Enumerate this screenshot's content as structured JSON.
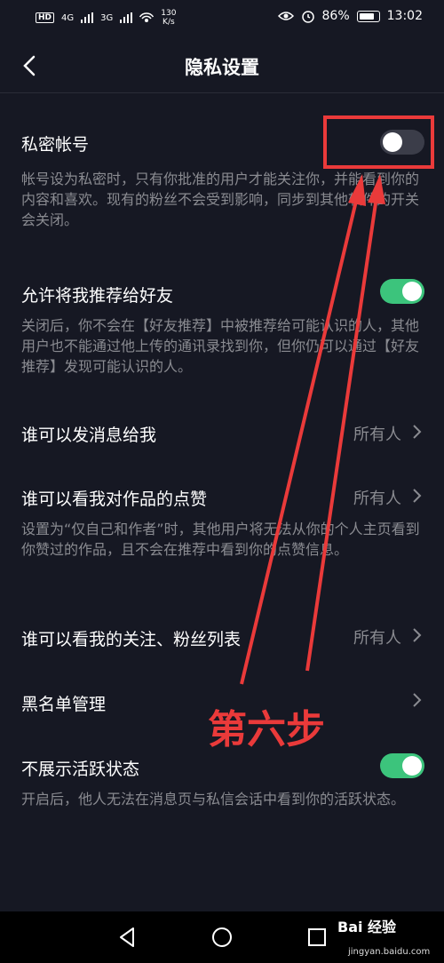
{
  "status_bar": {
    "network_chip": "HD",
    "signal_1": "4G",
    "signal_2": "3G",
    "speed_value": "130",
    "speed_unit": "K/s",
    "battery": "86%",
    "battery_level": 0.86,
    "time": "13:02"
  },
  "header": {
    "title": "隐私设置"
  },
  "settings": {
    "private_account": {
      "title": "私密帐号",
      "description": "帐号设为私密时，只有你批准的用户才能关注你，并能看到你的内容和喜欢。现有的粉丝不会受到影响，同步到其他软件的开关会关闭。",
      "toggle_on": false
    },
    "recommend_friends": {
      "title": "允许将我推荐给好友",
      "description": "关闭后，你不会在【好友推荐】中被推荐给可能认识的人，其他用户也不能通过他上传的通讯录找到你，但你仍可以通过【好友推荐】发现可能认识的人。",
      "toggle_on": true
    },
    "who_can_message": {
      "title": "谁可以发消息给我",
      "value": "所有人"
    },
    "who_can_see_likes": {
      "title": "谁可以看我对作品的点赞",
      "value": "所有人",
      "description": "设置为“仅自己和作者”时，其他用户将无法从你的个人主页看到你赞过的作品，且不会在推荐中看到你的点赞信息。"
    },
    "who_can_see_follows": {
      "title": "谁可以看我的关注、粉丝列表",
      "value": "所有人"
    },
    "blacklist": {
      "title": "黑名单管理"
    },
    "hide_activity": {
      "title": "不展示活跃状态",
      "description": "开启后，他人无法在消息页与私信会话中看到你的活跃状态。",
      "toggle_on": true
    }
  },
  "annotation": {
    "text": "第六步",
    "color": "#ea3a3a"
  },
  "colors": {
    "background": "#161823",
    "toggle_on": "#3cc47c",
    "toggle_off": "#3b3d49",
    "secondary_text": "#8a8b91"
  },
  "watermark": {
    "brand": "Bai 经验",
    "url": "jingyan.baidu.com"
  }
}
